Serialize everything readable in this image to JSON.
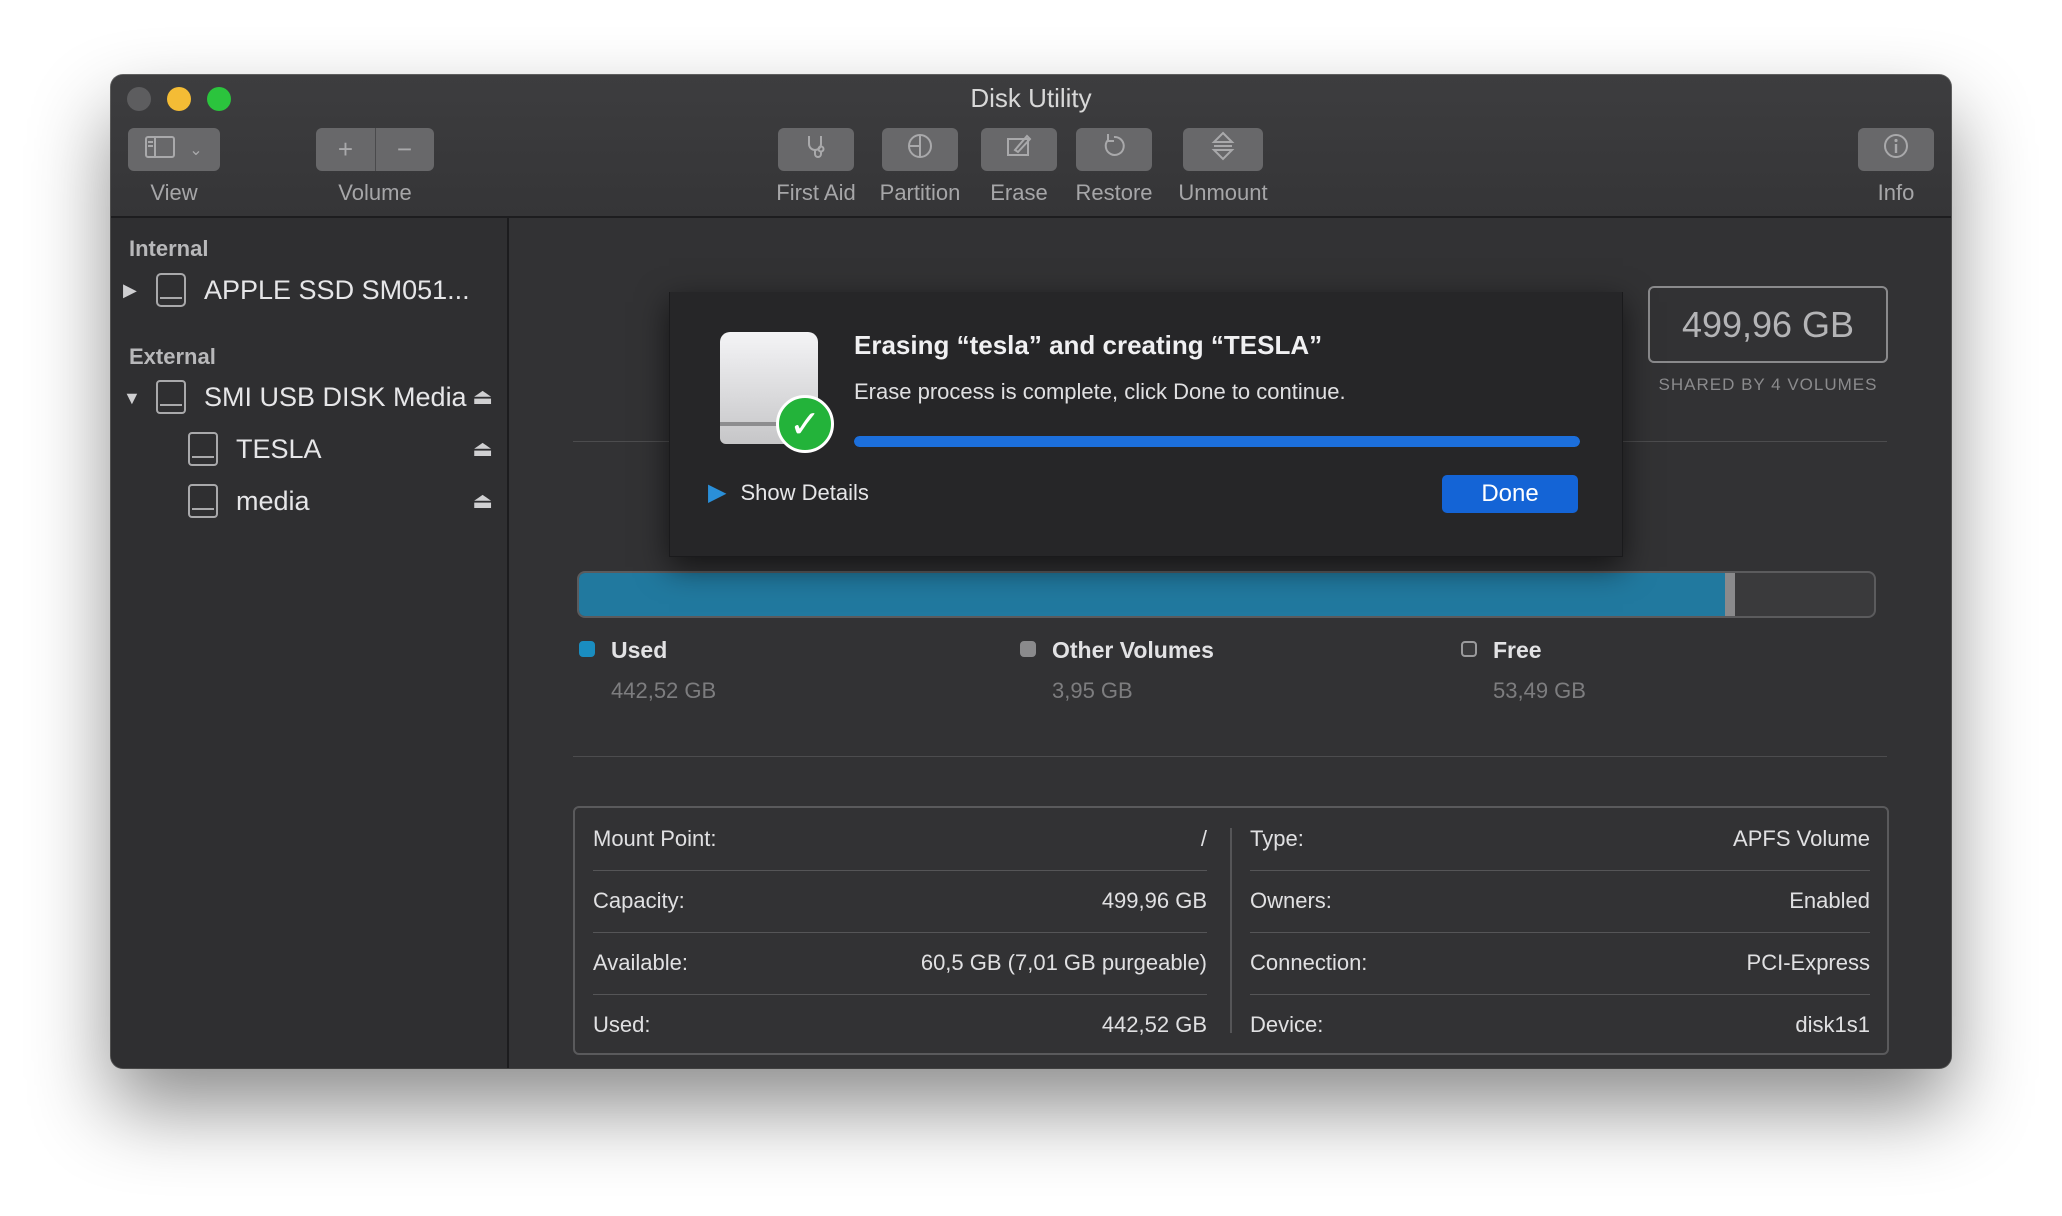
{
  "window": {
    "title": "Disk Utility"
  },
  "toolbar": {
    "view_label": "View",
    "volume_label": "Volume",
    "first_aid_label": "First Aid",
    "partition_label": "Partition",
    "erase_label": "Erase",
    "restore_label": "Restore",
    "unmount_label": "Unmount",
    "info_label": "Info"
  },
  "sidebar": {
    "internal_header": "Internal",
    "internal_disk": "APPLE SSD SM051...",
    "external_header": "External",
    "external_disk": "SMI USB DISK Media",
    "volumes": [
      "TESLA",
      "media"
    ]
  },
  "capacity": {
    "total": "499,96 GB",
    "shared_label": "SHARED BY 4 VOLUMES"
  },
  "usage": {
    "used_fraction": 0.8851,
    "other_fraction": 0.0079,
    "used_color": "#21799f",
    "legend": [
      {
        "label": "Used",
        "value": "442,52 GB",
        "color": "#1a8dc0"
      },
      {
        "label": "Other Volumes",
        "value": "3,95 GB",
        "color": "#8a8a8c"
      },
      {
        "label": "Free",
        "value": "53,49 GB",
        "color": "#3a3a3c"
      }
    ]
  },
  "info": {
    "left": [
      {
        "key": "Mount Point:",
        "value": "/"
      },
      {
        "key": "Capacity:",
        "value": "499,96 GB"
      },
      {
        "key": "Available:",
        "value": "60,5 GB (7,01 GB purgeable)"
      },
      {
        "key": "Used:",
        "value": "442,52 GB"
      }
    ],
    "right": [
      {
        "key": "Type:",
        "value": "APFS Volume"
      },
      {
        "key": "Owners:",
        "value": "Enabled"
      },
      {
        "key": "Connection:",
        "value": "PCI-Express"
      },
      {
        "key": "Device:",
        "value": "disk1s1"
      }
    ]
  },
  "sheet": {
    "title": "Erasing “tesla” and creating “TESLA”",
    "message": "Erase process is complete, click Done to continue.",
    "progress": 1.0,
    "show_details": "Show Details",
    "done_label": "Done"
  }
}
